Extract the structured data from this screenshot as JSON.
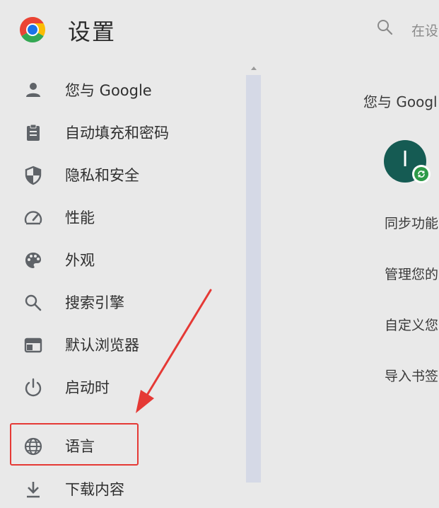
{
  "header": {
    "title": "设置",
    "search_placeholder": "在设",
    "logo_icon": "chrome-logo",
    "search_icon": "search-icon"
  },
  "sidebar": {
    "items": [
      {
        "label": "您与 Google",
        "icon": "person-icon"
      },
      {
        "label": "自动填充和密码",
        "icon": "clipboard-icon"
      },
      {
        "label": "隐私和安全",
        "icon": "shield-icon"
      },
      {
        "label": "性能",
        "icon": "speedometer-icon"
      },
      {
        "label": "外观",
        "icon": "palette-icon"
      },
      {
        "label": "搜索引擎",
        "icon": "search-icon"
      },
      {
        "label": "默认浏览器",
        "icon": "browser-window-icon"
      },
      {
        "label": "启动时",
        "icon": "power-icon"
      },
      {
        "label": "语言",
        "icon": "globe-icon"
      },
      {
        "label": "下载内容",
        "icon": "download-icon"
      }
    ],
    "highlighted_item": "语言"
  },
  "main": {
    "section_title": "您与 Googl",
    "avatar_letter": "I",
    "items": [
      "同步功能",
      "管理您的",
      "自定义您",
      "导入书签"
    ]
  },
  "colors": {
    "background": "#e9e9e9",
    "annotation_red": "#e53935",
    "avatar": "#155b53",
    "sync_badge": "#2e9a48",
    "scrollbar": "#d5d9e6",
    "icon_gray": "#5f6368"
  }
}
